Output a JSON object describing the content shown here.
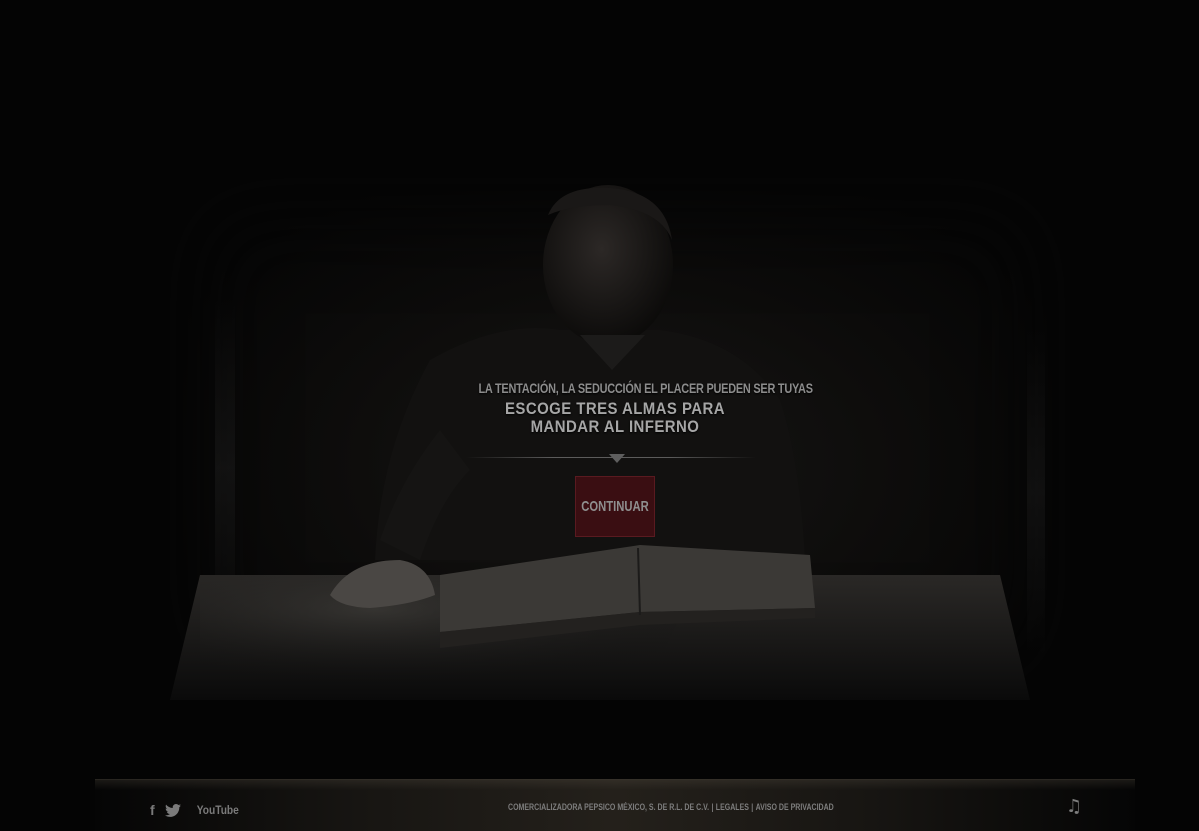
{
  "intro": {
    "tagline": "LA TENTACIÓN, LA SEDUCCIÓN EL PLACER PUEDEN SER TUYAS",
    "heading_line1": "ESCOGE TRES ALMAS PARA",
    "heading_line2": "MANDAR AL INFERNO"
  },
  "continue_button": {
    "label": "CONTINUAR",
    "color": "#3a0e12"
  },
  "footer": {
    "social": {
      "facebook_icon": "f",
      "twitter_icon": "twitter-bird",
      "youtube_label": "YouTube"
    },
    "legal": {
      "company": "COMERCIALIZADORA PEPSICO MÉXICO, S. DE R.L. DE C.V.",
      "legales": "LEGALES",
      "aviso": "AVISO DE PRIVACIDAD",
      "separator": "|"
    },
    "music_icon": "♫"
  }
}
